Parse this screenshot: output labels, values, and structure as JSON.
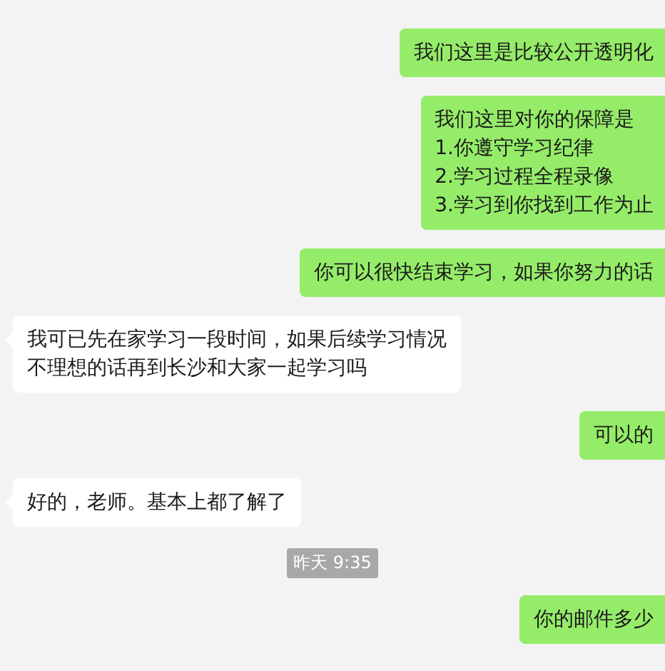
{
  "messages": [
    {
      "kind": "sent",
      "lines": [
        "我们这里是比较公开透明化"
      ]
    },
    {
      "kind": "sent",
      "lines": [
        "我们这里对你的保障是",
        "1.你遵守学习纪律",
        "2.学习过程全程录像",
        "3.学习到你找到工作为止"
      ]
    },
    {
      "kind": "sent",
      "lines": [
        "你可以很快结束学习，如果你努力的话"
      ]
    },
    {
      "kind": "received",
      "lines": [
        "我可已先在家学习一段时间，如果后续学习情况",
        "不理想的话再到长沙和大家一起学习吗"
      ]
    },
    {
      "kind": "sent",
      "lines": [
        "可以的"
      ]
    },
    {
      "kind": "received",
      "lines": [
        "好的，老师。基本上都了解了"
      ]
    },
    {
      "kind": "time",
      "text": "昨天 9:35"
    },
    {
      "kind": "sent",
      "lines": [
        "你的邮件多少"
      ]
    }
  ]
}
